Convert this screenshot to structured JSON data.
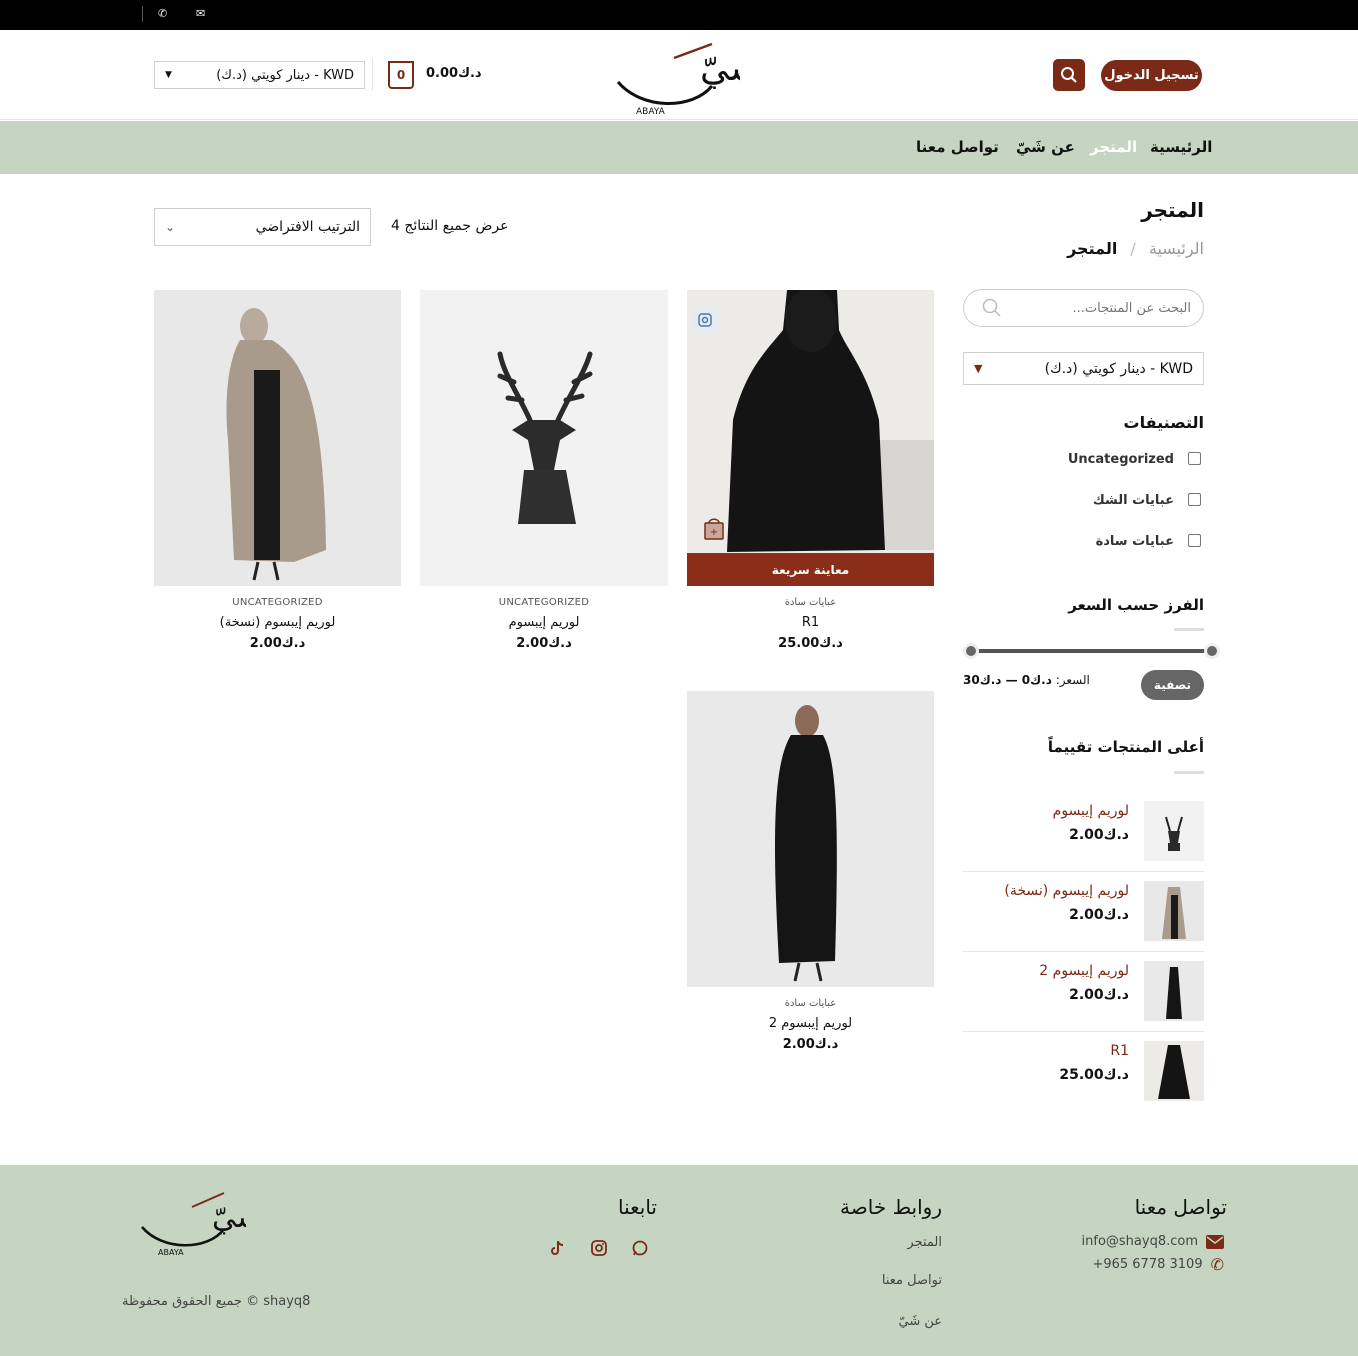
{
  "topbar": {
    "phone_icon": "phone-icon",
    "email_icon": "email-icon"
  },
  "header": {
    "currency_select": "دينار كويتي (د.ك) - KWD",
    "cart_count": "0",
    "cart_total": "د.ك0.00",
    "logo_text": "شيّ",
    "logo_sub": "ABAYA",
    "login_label": "تسجيل الدخول"
  },
  "nav": {
    "items": [
      "الرئيسية",
      "المتجر",
      "عن شَيّ",
      "تواصل معنا"
    ],
    "active": "المتجر"
  },
  "page": {
    "title": "المتجر",
    "breadcrumb_home": "الرئيسية",
    "breadcrumb_sep": "/",
    "breadcrumb_current": "المتجر",
    "result_count": "عرض جميع النتائج 4",
    "sort_select": "الترتيب الافتراضي"
  },
  "products": [
    {
      "category": "عبايات سادة",
      "name": "R1",
      "price": "د.ك25.00",
      "quick_view": "معاينة سريعة"
    },
    {
      "category": "UNCATEGORIZED",
      "name": "لوريم إيبسوم",
      "price": "د.ك2.00"
    },
    {
      "category": "UNCATEGORIZED",
      "name": "لوريم إيبسوم (نسخة)",
      "price": "د.ك2.00"
    },
    {
      "category": "عبايات سادة",
      "name": "لوريم إيبسوم 2",
      "price": "د.ك2.00"
    }
  ],
  "sidebar": {
    "search_placeholder": "البحث عن المنتجات...",
    "currency_select": "دينار كويتي (د.ك) - KWD",
    "categories_title": "التصنيفات",
    "categories": [
      "Uncategorized",
      "عبايات الشك",
      "عبايات سادة"
    ],
    "price_filter_title": "الفرز حسب السعر",
    "price_range_label": "السعر:",
    "price_range_value": "د.ك0 — د.ك30",
    "price_min_fraction": 0,
    "price_max_fraction": 1,
    "filter_button": "تصفية",
    "top_rated_title": "أعلى المنتجات تقييماً",
    "top_rated": [
      {
        "name": "لوريم إيبسوم",
        "price": "د.ك2.00"
      },
      {
        "name": "لوريم إيبسوم (نسخة)",
        "price": "د.ك2.00"
      },
      {
        "name": "لوريم إيبسوم 2",
        "price": "د.ك2.00"
      },
      {
        "name": "R1",
        "price": "د.ك25.00"
      }
    ]
  },
  "footer": {
    "contact_title": "تواصل معنا",
    "email": "info@shayq8.com",
    "phone": "+965 6778 3109",
    "links_title": "روابط خاصة",
    "links": [
      "المتجر",
      "تواصل معنا",
      "عن شَيّ"
    ],
    "follow_title": "تابعنا",
    "social_icons": [
      "tiktok-icon",
      "instagram-icon",
      "whatsapp-icon"
    ],
    "logo_text": "شيّ",
    "logo_sub": "ABAYA",
    "copyright": "shayq8 © جميع الحقوق محفوظة"
  },
  "colors": {
    "brand": "#7a2a17",
    "nav_bg": "#c5d5c1",
    "topbar": "#000000"
  }
}
